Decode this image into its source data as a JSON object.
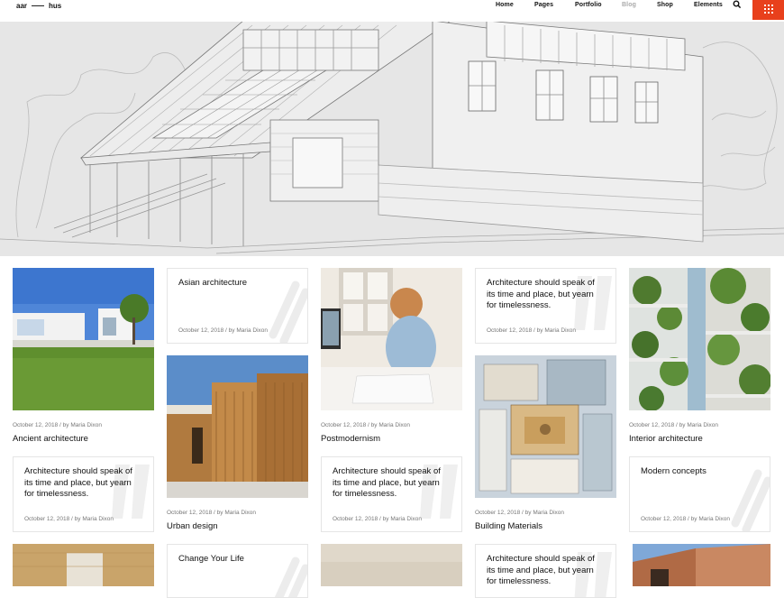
{
  "header": {
    "logo_left": "aar",
    "logo_right": "hus",
    "nav": [
      "Home",
      "Pages",
      "Portfolio",
      "Blog",
      "Shop",
      "Elements"
    ],
    "active_nav": "Blog",
    "accent_color": "#e8401c"
  },
  "posts": {
    "ancient": {
      "meta": "October 12, 2018 / by Maria Dixon",
      "title": "Ancient architecture"
    },
    "asian": {
      "meta": "October 12, 2018 / by Maria Dixon",
      "title": "Asian architecture"
    },
    "quote_a": {
      "meta": "October 12, 2018 / by Maria Dixon",
      "title": "Architecture should speak of its time and place, but yearn for timelessness."
    },
    "interior": {
      "meta": "October 12, 2018 / by Maria Dixon",
      "title": "Interior architecture"
    },
    "quote_b": {
      "meta": "October 12, 2018 / by Maria Dixon",
      "title": "Architecture should speak of its time and place, but yearn for timelessness."
    },
    "urban": {
      "meta": "October 12, 2018 / by Maria Dixon",
      "title": "Urban design"
    },
    "postmodernism": {
      "meta": "October 12, 2018 / by Maria Dixon",
      "title": "Postmodernism"
    },
    "quote_c": {
      "meta": "October 12, 2018 / by Maria Dixon",
      "title": "Architecture should speak of its time and place, but yearn for timelessness."
    },
    "building": {
      "meta": "October 12, 2018 / by Maria Dixon",
      "title": "Building Materials"
    },
    "modern": {
      "meta": "October 12, 2018 / by Maria Dixon",
      "title": "Modern concepts"
    },
    "change": {
      "title": "Change Your Life"
    },
    "quote_d": {
      "title": "Architecture should speak of its time and place, but yearn for timelessness."
    }
  }
}
